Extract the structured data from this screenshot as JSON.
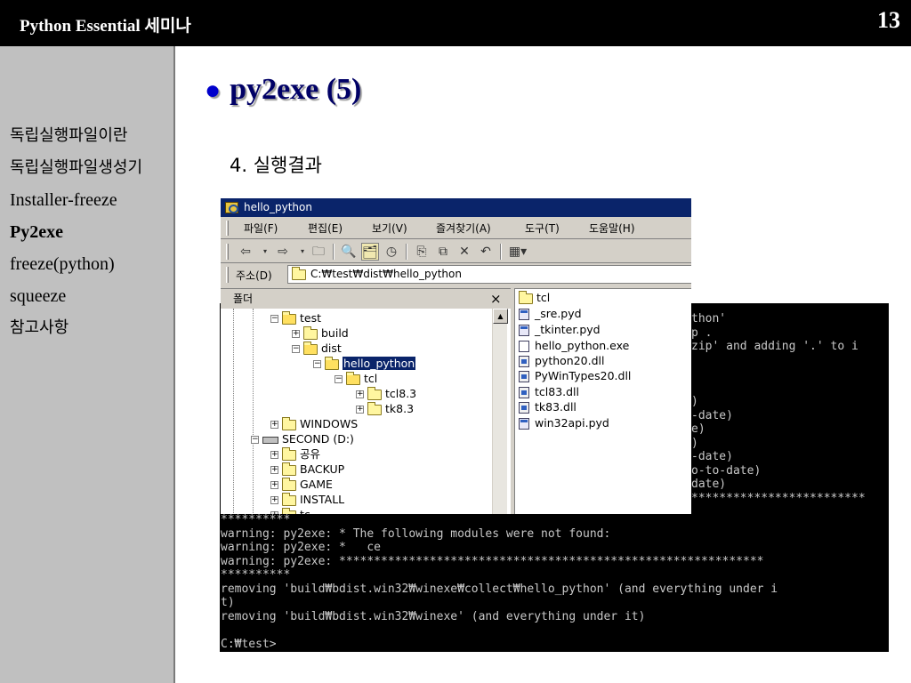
{
  "header": {
    "title": "Python Essential 세미나",
    "page_number": "13"
  },
  "sidebar": {
    "items": [
      {
        "label": "독립실행파일이란"
      },
      {
        "label": "독립실행파일생성기"
      },
      {
        "label": "Installer-freeze"
      },
      {
        "label": "Py2exe",
        "active": true
      },
      {
        "label": "freeze(python)"
      },
      {
        "label": "squeeze"
      },
      {
        "label": "참고사항"
      }
    ]
  },
  "slide": {
    "title": "py2exe (5)",
    "bullet": "●",
    "subtitle": "4. 실행결과"
  },
  "explorer": {
    "window_title": "hello_python",
    "menu": [
      "파일(F)",
      "편집(E)",
      "보기(V)",
      "즐겨찾기(A)",
      "도구(T)",
      "도움말(H)"
    ],
    "toolbar": {
      "back": "⇦",
      "forward": "⇨",
      "up": "🗀",
      "search": "🔍",
      "folders": "🗂",
      "history": "◷",
      "move": "⎘",
      "copy": "⧉",
      "delete": "✕",
      "undo": "↶",
      "views": "▦▾"
    },
    "address_label": "주소(D)",
    "address_value": "C:₩test₩dist₩hello_python",
    "folder_pane_title": "폴더",
    "folder_pane_close": "×",
    "tree": [
      {
        "label": "test",
        "expander": "⊟",
        "icon": "folder-open"
      },
      {
        "label": "build",
        "expander": "⊞",
        "icon": "folder"
      },
      {
        "label": "dist",
        "expander": "⊟",
        "icon": "folder-open"
      },
      {
        "label": "hello_python",
        "expander": "⊟",
        "icon": "folder-open",
        "selected": true
      },
      {
        "label": "tcl",
        "expander": "⊟",
        "icon": "folder-open"
      },
      {
        "label": "tcl8.3",
        "expander": "⊞",
        "icon": "folder"
      },
      {
        "label": "tk8.3",
        "expander": "⊞",
        "icon": "folder"
      },
      {
        "label": "WINDOWS",
        "expander": "⊞",
        "icon": "folder"
      },
      {
        "label": "SECOND (D:)",
        "expander": "⊟",
        "icon": "drive"
      },
      {
        "label": "공유",
        "expander": "⊞",
        "icon": "folder"
      },
      {
        "label": "BACKUP",
        "expander": "⊞",
        "icon": "folder"
      },
      {
        "label": "GAME",
        "expander": "⊞",
        "icon": "folder"
      },
      {
        "label": "INSTALL",
        "expander": "⊞",
        "icon": "folder"
      },
      {
        "label": "tc",
        "expander": "⊞",
        "icon": "folder"
      }
    ],
    "files": [
      {
        "name": "tcl",
        "icon": "folder"
      },
      {
        "name": "_sre.pyd",
        "icon": "pyd"
      },
      {
        "name": "_tkinter.pyd",
        "icon": "pyd"
      },
      {
        "name": "hello_python.exe",
        "icon": "exe"
      },
      {
        "name": "python20.dll",
        "icon": "dll"
      },
      {
        "name": "PyWinTypes20.dll",
        "icon": "dll"
      },
      {
        "name": "tcl83.dll",
        "icon": "dll"
      },
      {
        "name": "tk83.dll",
        "icon": "dll"
      },
      {
        "name": "win32api.pyd",
        "icon": "pyd"
      }
    ]
  },
  "console": {
    "top_text": "thon'\np .\nzip' and adding '.' to i\n\n\n\n)\n-date)\ne)\n)\n-date)\no-to-date)\ndate)\n*************************",
    "bottom_text": "**********\nwarning: py2exe: * The following modules were not found:\nwarning: py2exe: *   ce\nwarning: py2exe: *************************************************************\n**********\nremoving 'build₩bdist.win32₩winexe₩collect₩hello_python' (and everything under i\nt)\nremoving 'build₩bdist.win32₩winexe' (and everything under it)\n\nC:₩test>"
  }
}
